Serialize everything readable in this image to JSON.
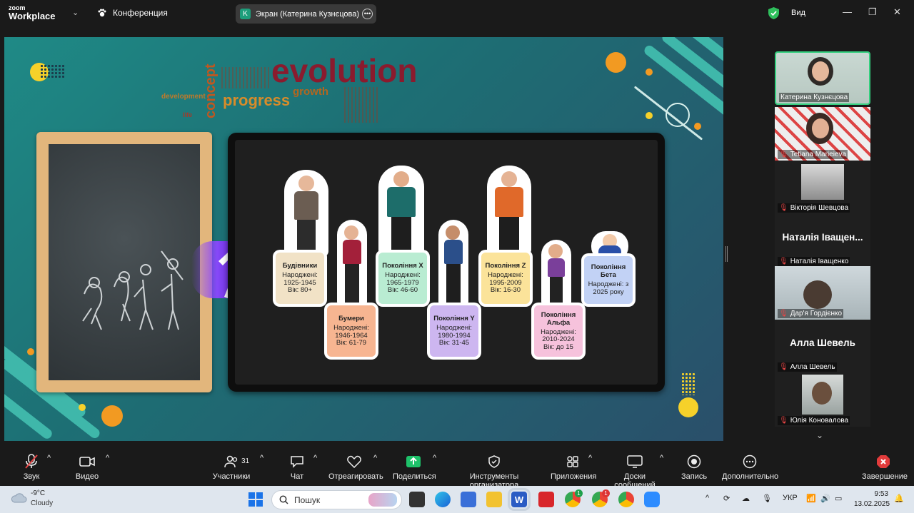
{
  "topbar": {
    "logo_small": "zoom",
    "logo_big": "Workplace",
    "meeting_label": "Конференция",
    "share_initial": "K",
    "share_label": "Экран (Катерина Кузнєцова)",
    "view_label": "Вид"
  },
  "slide": {
    "wordcloud": {
      "evolution": "evolution",
      "progress": "progress",
      "growth": "growth",
      "concept": "concept",
      "development": "development",
      "life": "life"
    },
    "generations": [
      {
        "title": "Будівники",
        "born_label": "Народжені:",
        "years": "1925-1945",
        "age": "Вік: 80+",
        "color": "#f1e2c6"
      },
      {
        "title": "Бумери",
        "born_label": "Народжені:",
        "years": "1946-1964",
        "age": "Вік: 61-79",
        "color": "#f7b591"
      },
      {
        "title": "Покоління X",
        "born_label": "Народжені:",
        "years": "1965-1979",
        "age": "Вік: 46-60",
        "color": "#b9ecd2"
      },
      {
        "title": "Покоління Y",
        "born_label": "Народжені:",
        "years": "1980-1994",
        "age": "Вік: 31-45",
        "color": "#cdb6f0"
      },
      {
        "title": "Покоління Z",
        "born_label": "Народжені:",
        "years": "1995-2009",
        "age": "Вік: 16-30",
        "color": "#fbe39a"
      },
      {
        "title": "Покоління Альфа",
        "born_label": "Народжені:",
        "years": "2010-2024",
        "age": "Вік: до 15",
        "color": "#f6c2dc"
      },
      {
        "title": "Покоління Бета",
        "born_label": "Народжені: з",
        "years": "2025 року",
        "age": "",
        "color": "#c2d2f5"
      }
    ]
  },
  "participants": [
    {
      "name": "Катерина Кузнєцова",
      "muted": false,
      "active": true
    },
    {
      "name": "Tetiana Marieieva",
      "muted": true
    },
    {
      "name": "Вікторія Шевцова",
      "muted": true
    },
    {
      "name": "Наталія Іващенко",
      "muted": true,
      "display_name": "Наталія Іващен..."
    },
    {
      "name": "Дар'я Гордієнко",
      "muted": true
    },
    {
      "name": "Алла Шевель",
      "muted": true,
      "display_name": "Алла Шевель"
    },
    {
      "name": "Юлія Коновалова",
      "muted": true
    }
  ],
  "toolbar": {
    "audio": "Звук",
    "video": "Видео",
    "participants": "Участники",
    "participants_count": "31",
    "chat": "Чат",
    "react": "Отреагировать",
    "share": "Поделиться",
    "host_tools": "Инструменты организатора",
    "apps": "Приложения",
    "whiteboards": "Доски сообщений",
    "record": "Запись",
    "more": "Дополнительно",
    "end": "Завершение"
  },
  "taskbar": {
    "temp": "-9°C",
    "weather": "Cloudy",
    "search_placeholder": "Пошук",
    "lang": "УКР",
    "time": "9:53",
    "date": "13.02.2025",
    "chrome_badge_1": "1",
    "chrome_badge_2": "1"
  },
  "colors": {
    "active_border": "#35d07f",
    "muted_red": "#e64545",
    "end_red": "#e23b3b",
    "share_green": "#1ec26a"
  }
}
